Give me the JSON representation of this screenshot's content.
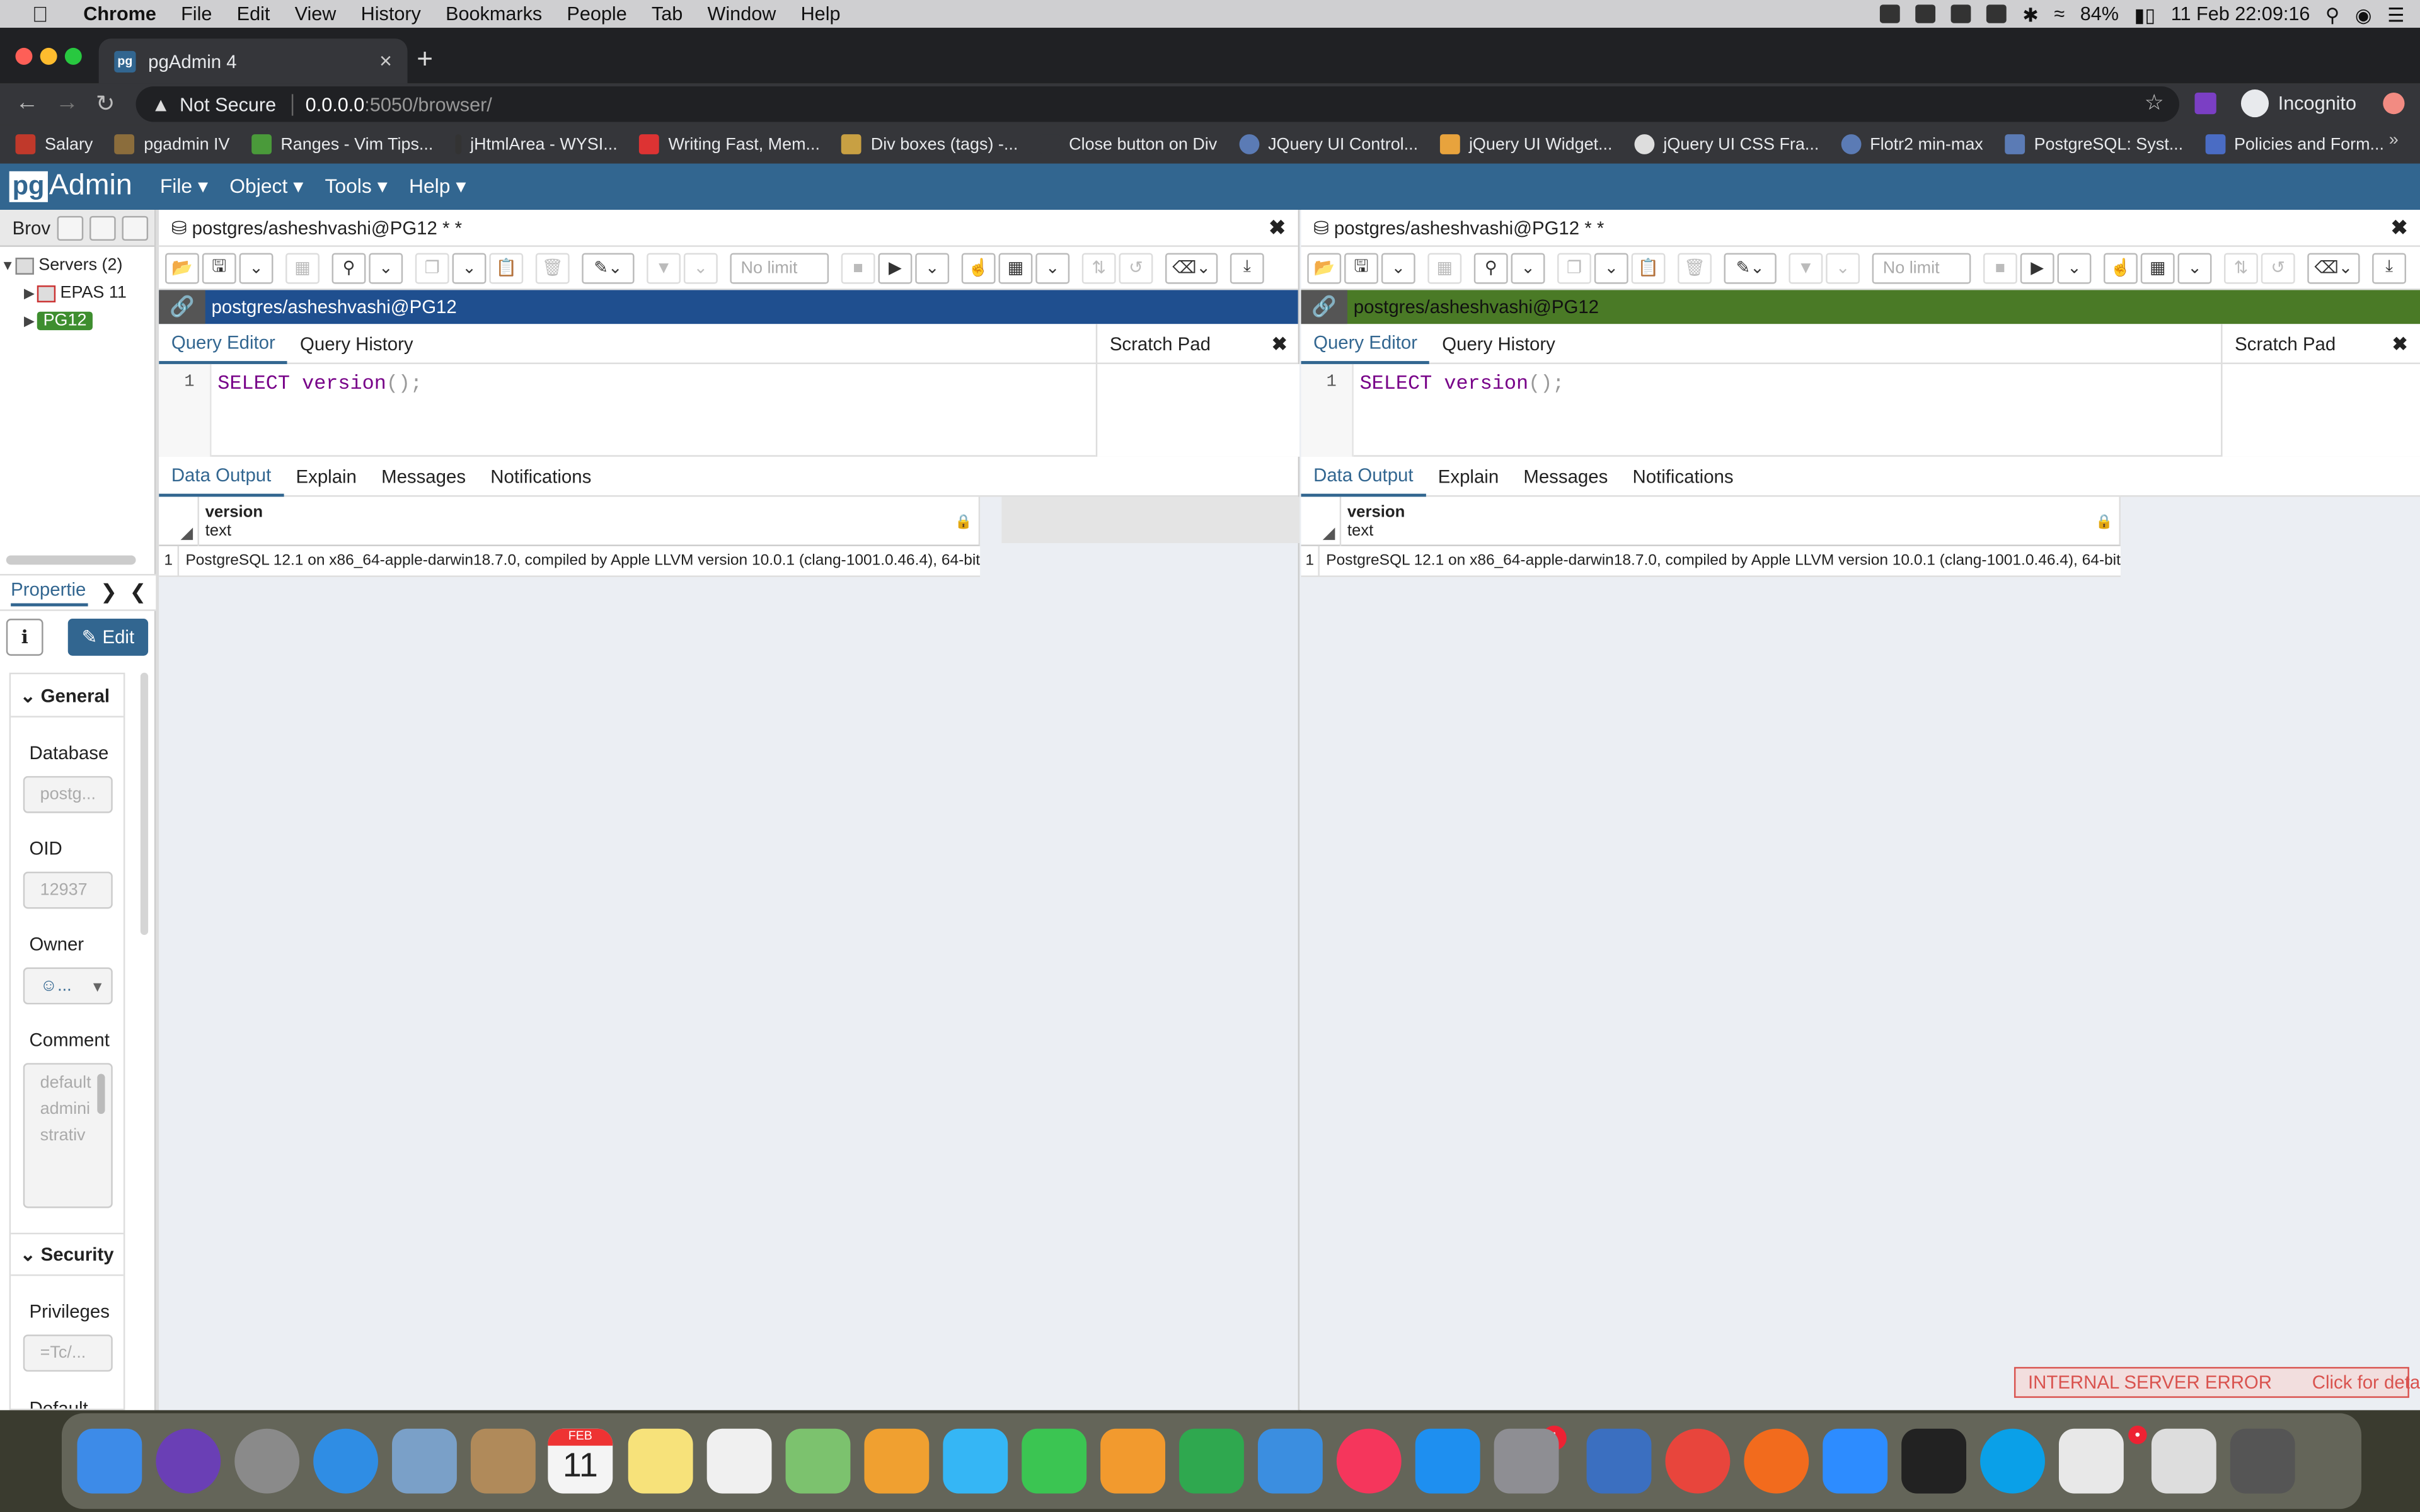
{
  "macos": {
    "apple_icon": "apple-icon",
    "app_name": "Chrome",
    "menu": [
      "File",
      "Edit",
      "View",
      "History",
      "Bookmarks",
      "People",
      "Tab",
      "Window",
      "Help"
    ],
    "battery": "84%",
    "datetime": "11 Feb  22:09:16"
  },
  "chrome": {
    "tab_title": "pgAdmin 4",
    "tab_favicon": "pg",
    "tab_close": "×",
    "new_tab": "+",
    "not_secure": "Not Secure",
    "url_host": "0.0.0.0",
    "url_path": ":5050/browser/",
    "incognito": "Incognito",
    "bookmarks": [
      {
        "label": "Salary",
        "color": "#c0392b"
      },
      {
        "label": "pgadmin IV",
        "color": "#8b6d3c"
      },
      {
        "label": "Ranges - Vim Tips...",
        "color": "#4a9a3a"
      },
      {
        "label": "jHtmlArea - WYSI...",
        "color": "#333333"
      },
      {
        "label": "Writing Fast, Mem...",
        "color": "#d33"
      },
      {
        "label": "Div boxes (tags) -...",
        "color": "#c8a043"
      },
      {
        "label": "Close button on Div",
        "color": "#35363a"
      },
      {
        "label": "JQuery UI Control...",
        "color": "#5b7bb5"
      },
      {
        "label": "jQuery UI Widget...",
        "color": "#e8a33d"
      },
      {
        "label": "jQuery UI CSS Fra...",
        "color": "#dddddd"
      },
      {
        "label": "Flotr2 min-max",
        "color": "#5b7bb5"
      },
      {
        "label": "PostgreSQL: Syst...",
        "color": "#5b7bb5"
      },
      {
        "label": "Policies and Form...",
        "color": "#4a6cc4"
      }
    ],
    "more": "»"
  },
  "pgadmin": {
    "logo_pg": "pg",
    "logo_admin": "Admin",
    "menu": [
      "File",
      "Object",
      "Tools",
      "Help"
    ],
    "browser_tab": "Brov",
    "tree": {
      "servers": "Servers (2)",
      "epas": "EPAS 11",
      "pg12": "PG12"
    },
    "properties_tab": "Propertie",
    "edit_button": "Edit",
    "general": "General",
    "database_label": "Database",
    "database_value": "postg...",
    "oid_label": "OID",
    "oid_value": "12937",
    "owner_label": "Owner",
    "owner_value": "...",
    "comment_label": "Comment",
    "comment_value": "default administrativ",
    "security": "Security",
    "privileges_label": "Privileges",
    "privileges_value": "=Tc/...",
    "default_label": "Default TABLE privileges",
    "error_text": "INTERNAL SERVER ERROR",
    "error_details": "Click for details."
  },
  "query_panels": [
    {
      "title": "postgres/asheshvashi@PG12 * *",
      "connection": "postgres/asheshvashi@PG12",
      "conn_color": "#1f4f8f",
      "tabs": [
        "Query Editor",
        "Query History"
      ],
      "scratch": "Scratch Pad",
      "line_no": "1",
      "sql_kw": "SELECT",
      "sql_fn": "version",
      "sql_rest": "();",
      "limit": "No limit",
      "output_tabs": [
        "Data Output",
        "Explain",
        "Messages",
        "Notifications"
      ],
      "col_name": "version",
      "col_type": "text",
      "row_no": "1",
      "row_value": "PostgreSQL 12.1 on x86_64-apple-darwin18.7.0, compiled by Apple LLVM version 10.0.1 (clang-1001.0.46.4), 64-bit"
    },
    {
      "title": "postgres/asheshvashi@PG12 * *",
      "connection": "postgres/asheshvashi@PG12",
      "conn_color": "#4a7a26",
      "tabs": [
        "Query Editor",
        "Query History"
      ],
      "scratch": "Scratch Pad",
      "line_no": "1",
      "sql_kw": "SELECT",
      "sql_fn": "version",
      "sql_rest": "();",
      "limit": "No limit",
      "output_tabs": [
        "Data Output",
        "Explain",
        "Messages",
        "Notifications"
      ],
      "col_name": "version",
      "col_type": "text",
      "row_no": "1",
      "row_value": "PostgreSQL 12.1 on x86_64-apple-darwin18.7.0, compiled by Apple LLVM version 10.0.1 (clang-1001.0.46.4), 64-bit"
    }
  ],
  "dock": [
    {
      "name": "finder-icon",
      "color": "#3d8be8"
    },
    {
      "name": "siri-icon",
      "color": "#6a3fb5"
    },
    {
      "name": "launchpad-icon",
      "color": "#8a8a8a"
    },
    {
      "name": "safari-icon",
      "color": "#2f8de4"
    },
    {
      "name": "mail-bird-icon",
      "color": "#7aa0c8"
    },
    {
      "name": "contacts-icon",
      "color": "#b08a5a"
    },
    {
      "name": "calendar-icon",
      "color": "#f2f2f2"
    },
    {
      "name": "notes-icon",
      "color": "#f7e27a"
    },
    {
      "name": "reminders-icon",
      "color": "#f0f0f0"
    },
    {
      "name": "maps-icon",
      "color": "#7cc26e"
    },
    {
      "name": "photos-icon",
      "color": "#f0a030"
    },
    {
      "name": "messages-icon",
      "color": "#35b6f5"
    },
    {
      "name": "facetime-icon",
      "color": "#3bc552"
    },
    {
      "name": "pages-icon",
      "color": "#f29a2e"
    },
    {
      "name": "numbers-icon",
      "color": "#2fa84f"
    },
    {
      "name": "keynote-icon",
      "color": "#3b8ee0"
    },
    {
      "name": "music-icon",
      "color": "#f5365c"
    },
    {
      "name": "app-store-icon",
      "color": "#1e8ff0"
    },
    {
      "name": "system-preferences-icon",
      "color": "#8e8e93"
    },
    {
      "name": "vmware-icon",
      "color": "#3b6fc0"
    },
    {
      "name": "chrome-icon",
      "color": "#e8453c"
    },
    {
      "name": "firefox-icon",
      "color": "#f26b1d"
    },
    {
      "name": "zoom-icon",
      "color": "#2d8cff"
    },
    {
      "name": "terminal-icon",
      "color": "#222222"
    },
    {
      "name": "skype-icon",
      "color": "#0aa0e8"
    },
    {
      "name": "slack-icon",
      "color": "#e8e8e8"
    },
    {
      "name": "documents-icon",
      "color": "#dddddd"
    },
    {
      "name": "trash-icon",
      "color": "#555555"
    }
  ],
  "dock_badges": {
    "system_preferences": "1",
    "slack": "•"
  },
  "calendar_month": "FEB",
  "calendar_day": "11"
}
